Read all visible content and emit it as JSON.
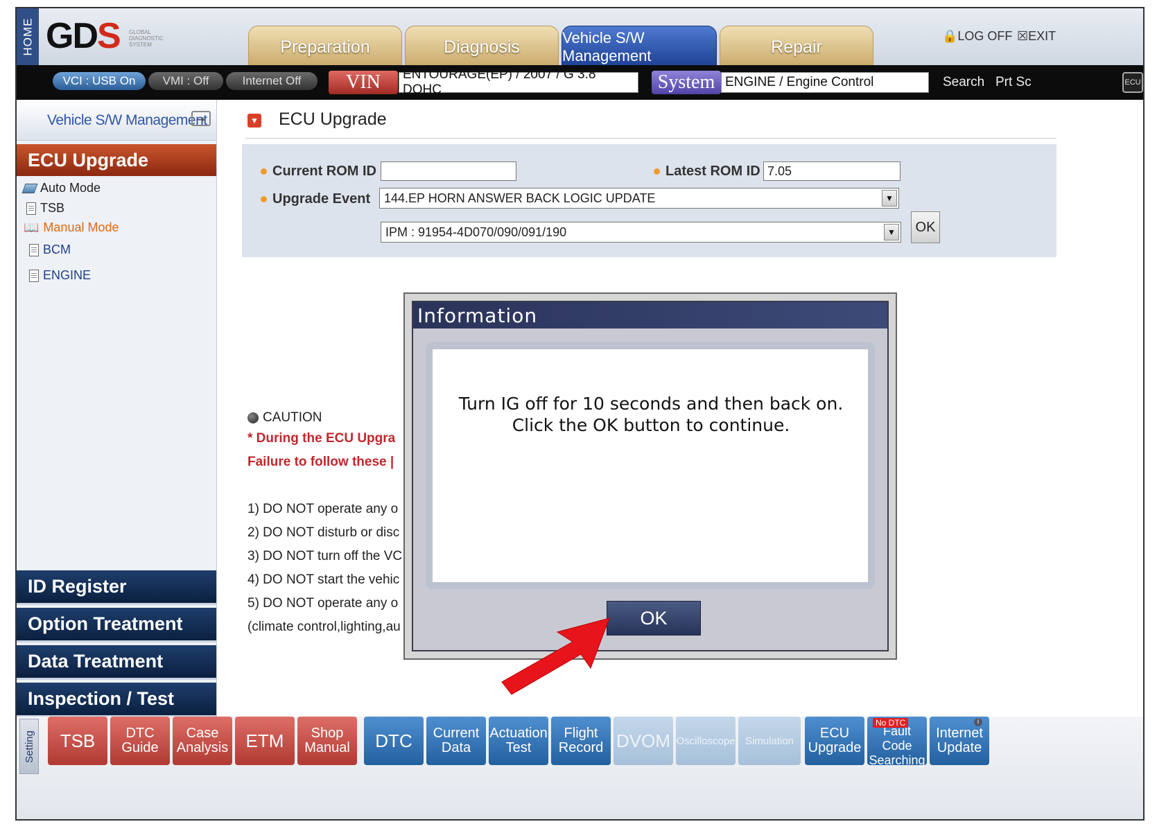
{
  "header": {
    "home_label": "HOME",
    "logo_main": "GD",
    "logo_accent": "S",
    "logo_sub": "GLOBAL DIAGNOSTIC SYSTEM",
    "tabs": [
      "Preparation",
      "Diagnosis",
      "Vehicle S/W Management",
      "Repair"
    ],
    "active_tab": "Vehicle S/W Management",
    "log_off": "LOG OFF",
    "exit": "EXIT"
  },
  "statusbar": {
    "vci": "VCI : USB On",
    "vmi": "VMI : Off",
    "internet": "Internet Off",
    "vin_label": "VIN",
    "vin_value": "ENTOURAGE(EP) / 2007 / G 3.8 DOHC",
    "system_label": "System",
    "system_value": "ENGINE / Engine Control",
    "search": "Search",
    "prtsc": "Prt Sc",
    "ecu_icon": "ECU"
  },
  "sidebar": {
    "header": "Vehicle S/W Management",
    "section": "ECU Upgrade",
    "items": [
      {
        "label": "Auto Mode"
      },
      {
        "label": "TSB"
      },
      {
        "label": "Manual Mode"
      },
      {
        "label": "BCM"
      },
      {
        "label": "ENGINE"
      }
    ],
    "bottom_buttons": [
      "ID Register",
      "Option Treatment",
      "Data Treatment",
      "Inspection / Test"
    ]
  },
  "main": {
    "title": "ECU Upgrade",
    "current_rom_label": "Current ROM ID",
    "current_rom_value": "",
    "latest_rom_label": "Latest ROM ID",
    "latest_rom_value": "7.05",
    "upgrade_event_label": "Upgrade Event",
    "upgrade_event_value": "144.EP HORN ANSWER BACK LOGIC UPDATE",
    "ipm_value": "IPM : 91954-4D070/090/091/190",
    "ok_label": "OK",
    "caution_title": "CAUTION",
    "caution_line1": "* During the ECU Upgra",
    "caution_line2": "Failure to follow these |",
    "rules": [
      "1) DO NOT operate any o",
      "2) DO NOT disturb or disc",
      "3) DO NOT turn off the VC",
      "4) DO NOT start the vehic",
      "5) DO NOT operate any o",
      "(climate control,lighting,au"
    ]
  },
  "dialog": {
    "title": "Information",
    "message": "Turn IG off for 10 seconds and then back on. Click the OK button to continue.",
    "ok": "OK"
  },
  "toolbar": {
    "setting": "Setting",
    "buttons": [
      {
        "l1": "TSB",
        "l2": ""
      },
      {
        "l1": "DTC",
        "l2": "Guide"
      },
      {
        "l1": "Case",
        "l2": "Analysis"
      },
      {
        "l1": "ETM",
        "l2": ""
      },
      {
        "l1": "Shop",
        "l2": "Manual"
      },
      {
        "l1": "DTC",
        "l2": ""
      },
      {
        "l1": "Current",
        "l2": "Data"
      },
      {
        "l1": "Actuation",
        "l2": "Test"
      },
      {
        "l1": "Flight",
        "l2": "Record"
      },
      {
        "l1": "DVOM",
        "l2": ""
      },
      {
        "l1": "Oscilloscope",
        "l2": ""
      },
      {
        "l1": "Simulation",
        "l2": ""
      },
      {
        "l1": "ECU",
        "l2": "Upgrade"
      },
      {
        "l1": "Fault Code",
        "l2": "Searching",
        "badge": "No DTC"
      },
      {
        "l1": "Internet",
        "l2": "Update",
        "badge": "i"
      }
    ]
  },
  "colors": {
    "accent_red": "#c0282e",
    "active_tab_blue": "#1c3f92",
    "sidebar_blue": "#0b2040",
    "pointer_arrow": "#e8141c"
  }
}
